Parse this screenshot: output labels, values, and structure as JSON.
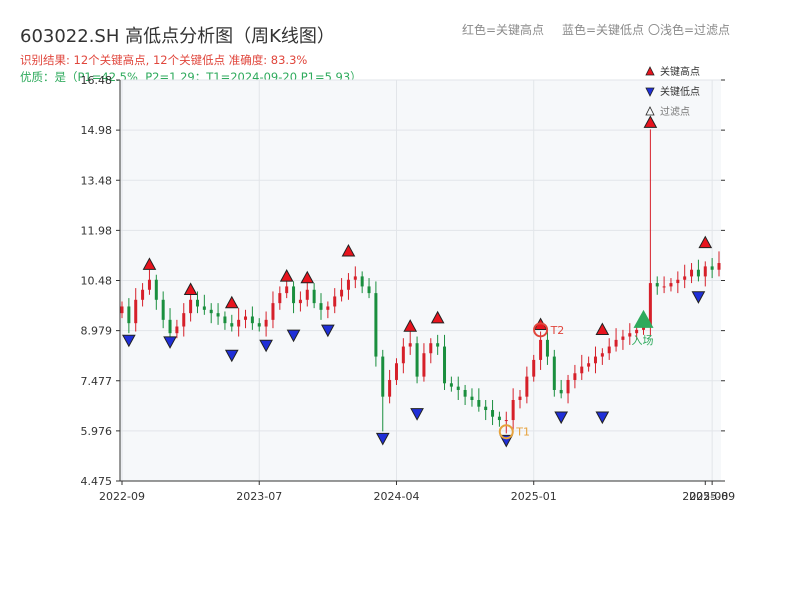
{
  "chart_data": {
    "type": "candlestick",
    "title": "603022.SH 高低点分析图（周K线图）",
    "subtitle_result": "识别结果: 12个关键高点, 12个关键低点 准确度: 83.3%",
    "subtitle_quality": "优质：是（P1=42.5%, P2=1.29；T1=2024-09-20 P1=5.93）",
    "top_legend": [
      "红色=关键高点",
      "蓝色=关键低点",
      "〇浅色=过滤点"
    ],
    "legend": [
      "关键高点",
      "关键低点",
      "过滤点"
    ],
    "y_ticks": [
      "4.475",
      "5.976",
      "7.477",
      "8.979",
      "10.48",
      "11.98",
      "13.48",
      "14.98",
      "16.48"
    ],
    "ylim": [
      4.475,
      16.48
    ],
    "x_ticks": [
      "2022-09",
      "2023-07",
      "2024-04",
      "2025-01",
      "2025-09"
    ],
    "x_extra_tick": "2025-08",
    "grid": true,
    "key_highs": [
      {
        "t": 4,
        "price": 10.75
      },
      {
        "t": 10,
        "price": 10.0
      },
      {
        "t": 16,
        "price": 9.6
      },
      {
        "t": 24,
        "price": 10.4
      },
      {
        "t": 27,
        "price": 10.35
      },
      {
        "t": 33,
        "price": 11.15
      },
      {
        "t": 42,
        "price": 8.9
      },
      {
        "t": 46,
        "price": 9.15
      },
      {
        "t": 61,
        "price": 8.95
      },
      {
        "t": 70,
        "price": 8.8
      },
      {
        "t": 77,
        "price": 15.0
      },
      {
        "t": 85,
        "price": 11.4
      }
    ],
    "key_lows": [
      {
        "t": 1,
        "price": 8.9
      },
      {
        "t": 7,
        "price": 8.85
      },
      {
        "t": 16,
        "price": 8.45
      },
      {
        "t": 21,
        "price": 8.75
      },
      {
        "t": 25,
        "price": 9.05
      },
      {
        "t": 30,
        "price": 9.2
      },
      {
        "t": 38,
        "price": 5.96
      },
      {
        "t": 43,
        "price": 6.7
      },
      {
        "t": 56,
        "price": 5.9
      },
      {
        "t": 64,
        "price": 6.6
      },
      {
        "t": 70,
        "price": 6.6
      },
      {
        "t": 84,
        "price": 10.2
      }
    ],
    "annotations": [
      {
        "label": "T2",
        "t": 61,
        "price": 9.0
      },
      {
        "label": "T1",
        "t": 56,
        "price": 5.95
      },
      {
        "label": "入场",
        "t": 76,
        "price": 9.3
      }
    ]
  }
}
